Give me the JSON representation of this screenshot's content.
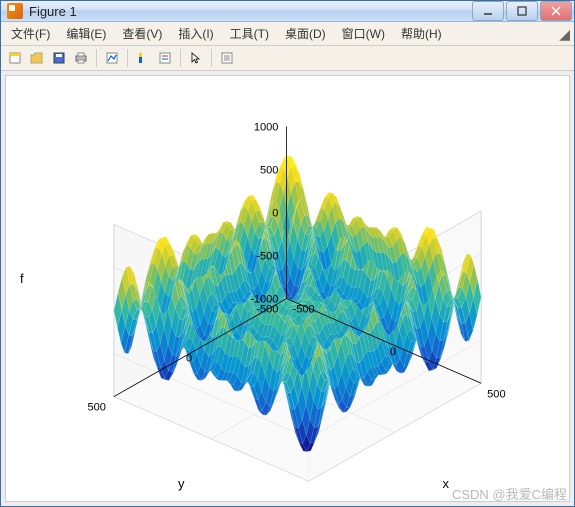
{
  "window": {
    "title": "Figure 1"
  },
  "menubar": {
    "items": [
      {
        "label": "文件(F)"
      },
      {
        "label": "编辑(E)"
      },
      {
        "label": "查看(V)"
      },
      {
        "label": "插入(I)"
      },
      {
        "label": "工具(T)"
      },
      {
        "label": "桌面(D)"
      },
      {
        "label": "窗口(W)"
      },
      {
        "label": "帮助(H)"
      }
    ]
  },
  "toolbar": {
    "items": [
      {
        "name": "new-figure-icon"
      },
      {
        "name": "open-icon"
      },
      {
        "name": "save-icon"
      },
      {
        "name": "print-icon"
      },
      {
        "name": "sep"
      },
      {
        "name": "edit-plot-icon"
      },
      {
        "name": "sep"
      },
      {
        "name": "insert-colorbar-icon"
      },
      {
        "name": "insert-legend-icon"
      },
      {
        "name": "sep"
      },
      {
        "name": "pointer-icon"
      },
      {
        "name": "sep"
      },
      {
        "name": "property-editor-icon"
      }
    ]
  },
  "chart_data": {
    "type": "surface_3d",
    "title": "",
    "xlabel": "x",
    "ylabel": "y",
    "zlabel": "f",
    "x_ticks": [
      -500,
      0,
      500
    ],
    "y_ticks": [
      -500,
      0,
      500
    ],
    "z_ticks": [
      -1000,
      -500,
      0,
      500,
      1000
    ],
    "xlim": [
      -500,
      500
    ],
    "ylim": [
      -500,
      500
    ],
    "zlim": [
      -1000,
      1000
    ],
    "colormap": "parula",
    "description": "Multi-peaked oscillatory surface mesh (Schwefel-like) over x,y in [-500,500], z-values approximately in [-900, 900]"
  },
  "watermark": "CSDN @我爱C编程"
}
